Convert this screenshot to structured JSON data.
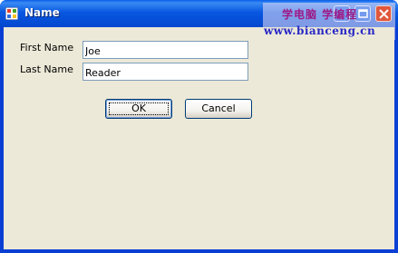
{
  "window": {
    "title": "Name",
    "app_icon": "windows-form-icon",
    "controls": {
      "minimize_icon": "minimize-icon",
      "maximize_icon": "maximize-icon",
      "close_icon": "close-icon"
    }
  },
  "watermark": {
    "line1": "学电脑 学编程",
    "line2": "www.bianceng.cn"
  },
  "form": {
    "first_name_label": "First Name",
    "first_name_value": "Joe",
    "last_name_label": "Last Name",
    "last_name_value": "Reader"
  },
  "buttons": {
    "ok_label": "OK",
    "cancel_label": "Cancel"
  },
  "colors": {
    "titlebar": "#0857e0",
    "client_background": "#ece9d8",
    "close_button": "#e0573b"
  }
}
